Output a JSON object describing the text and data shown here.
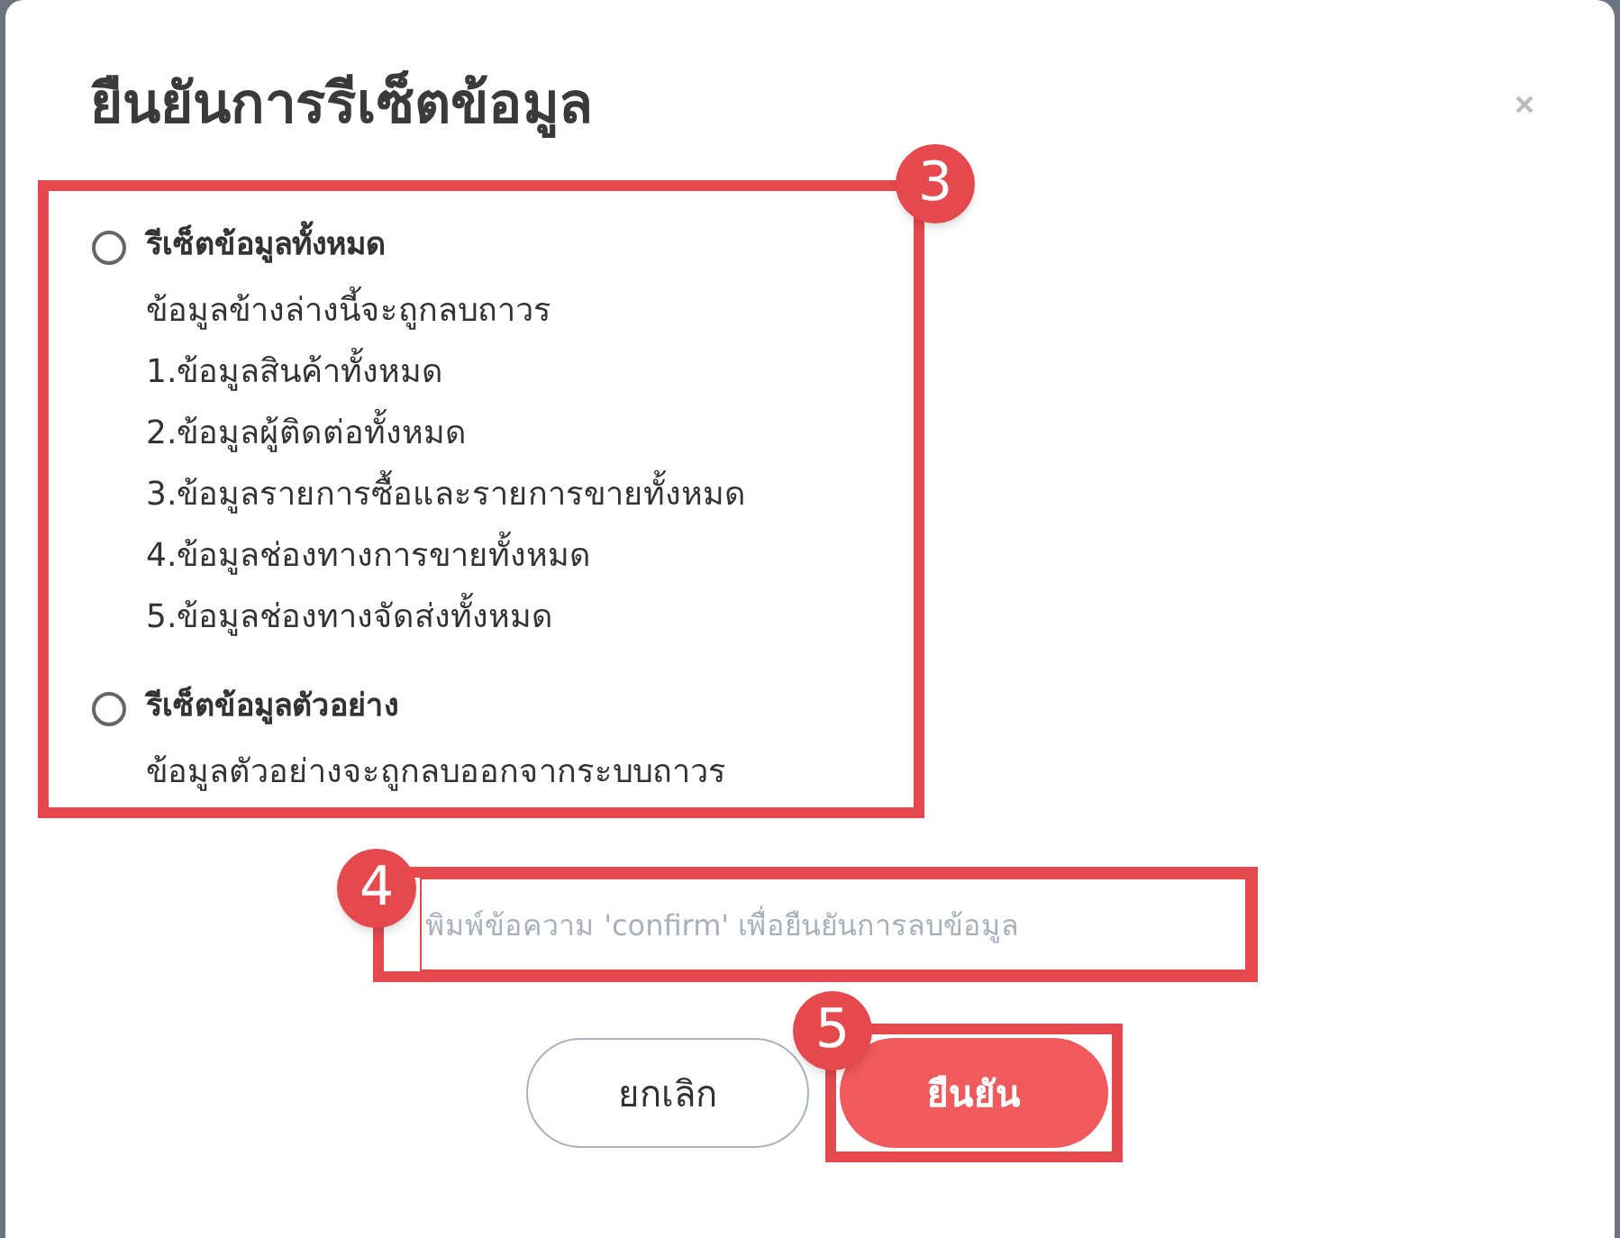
{
  "dialog": {
    "title": "ยืนยันการรีเซ็ตข้อมูล",
    "options": [
      {
        "label": "รีเซ็ตข้อมูลทั้งหมด",
        "selected": false,
        "lines": [
          "ข้อมูลข้างล่างนี้จะถูกลบถาวร",
          "1.ข้อมูลสินค้าทั้งหมด",
          "2.ข้อมูลผู้ติดต่อทั้งหมด",
          "3.ข้อมูลรายการซื้อและรายการขายทั้งหมด",
          "4.ข้อมูลช่องทางการขายทั้งหมด",
          "5.ข้อมูลช่องทางจัดส่งทั้งหมด"
        ]
      },
      {
        "label": "รีเซ็ตข้อมูลตัวอย่าง",
        "selected": false,
        "lines": [
          "ข้อมูลตัวอย่างจะถูกลบออกจากระบบถาวร"
        ]
      }
    ],
    "confirm_field": {
      "placeholder": "พิมพ์ข้อความ 'confirm' เพื่อยืนยันการลบข้อมูล"
    },
    "buttons": [
      {
        "label": "ยกเลิก",
        "kind": "secondary"
      },
      {
        "label": "ยืนยัน",
        "kind": "primary"
      }
    ]
  },
  "annotations": {
    "options": "3",
    "field": "4",
    "buttons": "5"
  }
}
